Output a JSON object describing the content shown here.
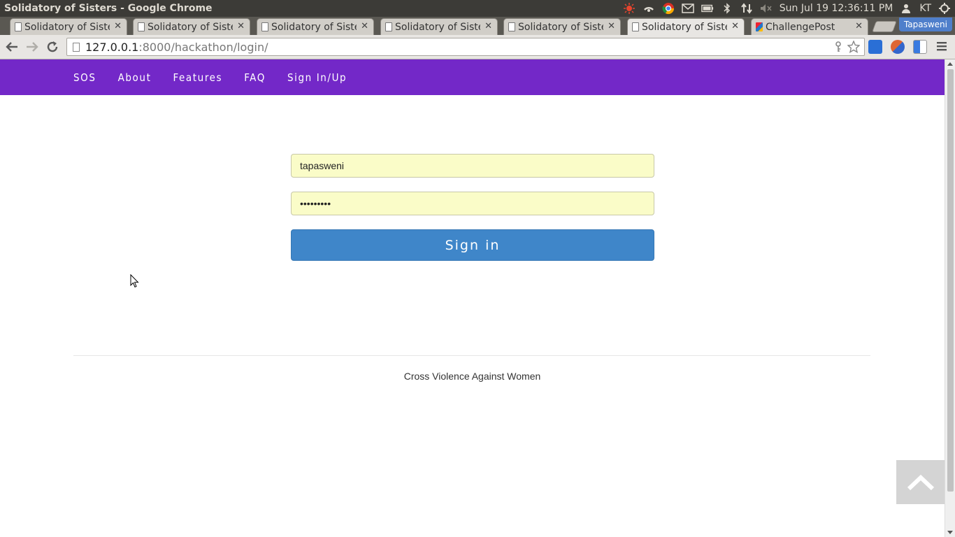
{
  "os": {
    "window_title": "Solidatory of Sisters - Google Chrome",
    "clock": "Sun Jul 19 12:36:11 PM",
    "user": "KT",
    "tray_icons": [
      "weather-icon",
      "wifi-icon",
      "chrome-icon",
      "mail-icon",
      "battery-icon",
      "bluetooth-icon",
      "network-icon",
      "volume-mute-icon",
      "user-icon",
      "power-icon"
    ]
  },
  "tabs": [
    {
      "label": "Solidatory of Sisters",
      "active": false
    },
    {
      "label": "Solidatory of Sisters",
      "active": false
    },
    {
      "label": "Solidatory of Sisters",
      "active": false
    },
    {
      "label": "Solidatory of Sisters",
      "active": false
    },
    {
      "label": "Solidatory of Sisters",
      "active": false
    },
    {
      "label": "Solidatory of Sisters",
      "active": true
    },
    {
      "label": "ChallengePost",
      "active": false
    }
  ],
  "profile_name": "Tapasweni",
  "address_bar": {
    "host": "127.0.0.1",
    "rest": ":8000/hackathon/login/"
  },
  "site_nav": {
    "items": [
      "SOS",
      "About",
      "Features",
      "FAQ",
      "Sign In/Up"
    ]
  },
  "login": {
    "username_value": "tapasweni",
    "password_value": "•••••••••",
    "submit_label": "Sign in"
  },
  "footer": {
    "text": "Cross Violence Against Women"
  },
  "colors": {
    "navbar": "#7328c8",
    "signin_button": "#3f86c9",
    "autofill_field": "#fafcc8"
  }
}
